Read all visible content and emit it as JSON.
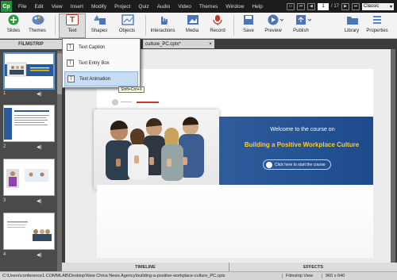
{
  "app": {
    "logo": "Cp"
  },
  "menu": [
    "File",
    "Edit",
    "View",
    "Insert",
    "Modify",
    "Project",
    "Quiz",
    "Audio",
    "Video",
    "Themes",
    "Window",
    "Help"
  ],
  "nav": {
    "page_current": "1",
    "page_total": "/ 17",
    "workspace": "Classic"
  },
  "toolbar": {
    "slides": "Slides",
    "themes": "Themes",
    "text": "Text",
    "shapes": "Shapes",
    "objects": "Objects",
    "interactions": "Interactions",
    "media": "Media",
    "record": "Record",
    "save": "Save",
    "preview": "Preview",
    "publish": "Publish",
    "library": "Library",
    "properties": "Properties"
  },
  "text_menu": {
    "items": [
      {
        "label": "Text Caption",
        "icon": "T"
      },
      {
        "label": "Text Entry Box",
        "icon": "T"
      },
      {
        "label": "Text Animation",
        "icon": "T"
      }
    ],
    "tooltip": "Shift+Ctrl+X"
  },
  "filmstrip": {
    "header": "FILMSTRIP",
    "slides": [
      {
        "num": "1"
      },
      {
        "num": "2"
      },
      {
        "num": "3"
      },
      {
        "num": "4"
      }
    ],
    "speaker": "◀)"
  },
  "tab": {
    "title": "culture_PC.cptx*",
    "close": "×"
  },
  "slide": {
    "welcome": "Welcome to the course on",
    "course": "Building a Positive Workplace Culture",
    "start": "Click here to start the course"
  },
  "bottom": {
    "timeline": "TIMELINE",
    "effects": "EFFECTS"
  },
  "status": {
    "path": "C:\\Users\\conference1.COMMLAB\\Desktop\\New China News Agency\\building-a-positive-workplace-culture_PC.cptx",
    "view": "Filmstrip View",
    "size": "960 x 640"
  }
}
